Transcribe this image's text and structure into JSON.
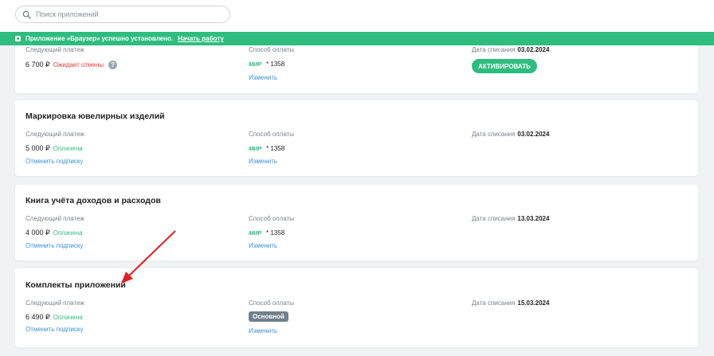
{
  "search": {
    "placeholder": "Поиск приложений"
  },
  "notice": {
    "text": "Приложение «Браузер» успешно установлено.",
    "link": "Начать работу"
  },
  "labels": {
    "next_payment": "Следующий платеж",
    "payment_method": "Способ оплаты",
    "charge_date": "Дата списания"
  },
  "cards": [
    {
      "title": "",
      "amount": "6 700 ₽",
      "status": "Ожидает отмены",
      "method_brand": "МИР",
      "method_card": "* 1358",
      "method_action": "Изменить",
      "date": "03.02.2024",
      "action": "АКТИВИРОВАТЬ"
    },
    {
      "title": "Маркировка ювелирных изделий",
      "amount": "5 000 ₽",
      "status": "Оплачена",
      "cancel": "Отменить подписку",
      "method_brand": "МИР",
      "method_card": "* 1358",
      "method_action": "Изменить",
      "date": "03.02.2024"
    },
    {
      "title": "Книга учёта доходов и расходов",
      "amount": "4 000 ₽",
      "status": "Оплачена",
      "cancel": "Отменить подписку",
      "method_brand": "МИР",
      "method_card": "* 1358",
      "method_action": "Изменить",
      "date": "13.03.2024"
    },
    {
      "title": "Комплекты приложений",
      "amount": "6 490 ₽",
      "status": "Оплачена",
      "cancel": "Отменить подписку",
      "method_badge": "Основной",
      "method_action": "Изменить",
      "date": "15.03.2024"
    }
  ],
  "colors": {
    "accent": "#2ebd7f",
    "link": "#3a8ed6",
    "danger": "#e23b3b",
    "arrow": "#e02020"
  }
}
